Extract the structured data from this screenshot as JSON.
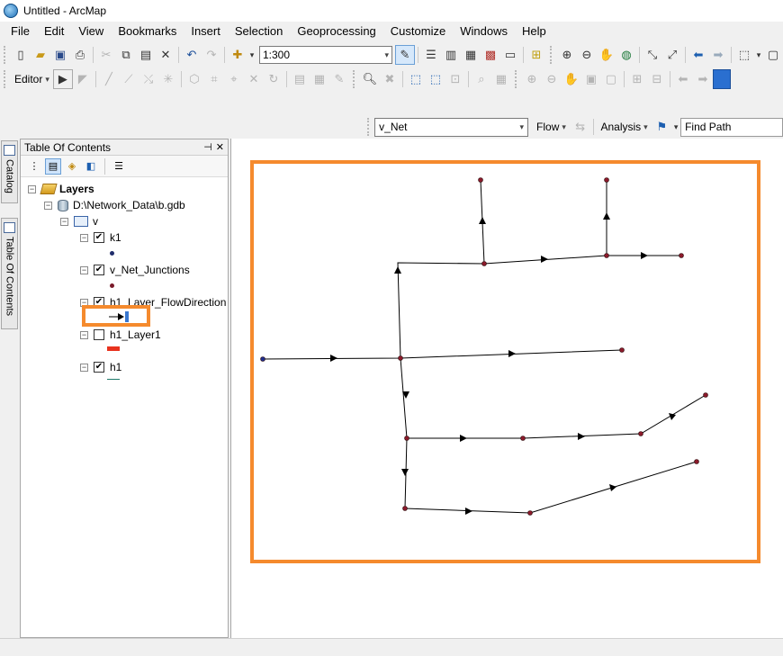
{
  "window": {
    "title": "Untitled - ArcMap"
  },
  "menu": [
    "File",
    "Edit",
    "View",
    "Bookmarks",
    "Insert",
    "Selection",
    "Geoprocessing",
    "Customize",
    "Windows",
    "Help"
  ],
  "toolbar": {
    "scale": "1:300",
    "editor_label": "Editor"
  },
  "network_toolbar": {
    "network_value": "v_Net",
    "flow_label": "Flow",
    "analysis_label": "Analysis",
    "find_path_value": "Find Path"
  },
  "side_tabs": {
    "catalog": "Catalog",
    "toc": "Table Of Contents"
  },
  "toc": {
    "title": "Table Of Contents",
    "root": "Layers",
    "database": "D:\\Network_Data\\b.gdb",
    "dataset": "v",
    "layers": [
      {
        "name": "k1",
        "checked": true,
        "swatch": "point",
        "color": "#1f2d6b"
      },
      {
        "name": "v_Net_Junctions",
        "checked": true,
        "swatch": "point",
        "color": "#7a1a2a"
      },
      {
        "name": "h1_Layer_FlowDirection",
        "checked": true,
        "swatch": "arrow",
        "color": "#000000"
      },
      {
        "name": "h1_Layer1",
        "checked": false,
        "swatch": "line",
        "color": "#e8321e"
      },
      {
        "name": "h1",
        "checked": true,
        "swatch": "line",
        "color": "#1f7a6b"
      }
    ]
  },
  "colors": {
    "highlight": "#f58a2d",
    "junction": "#8b1a2b",
    "source_point": "#1f2d8b",
    "edge": "#000000"
  }
}
